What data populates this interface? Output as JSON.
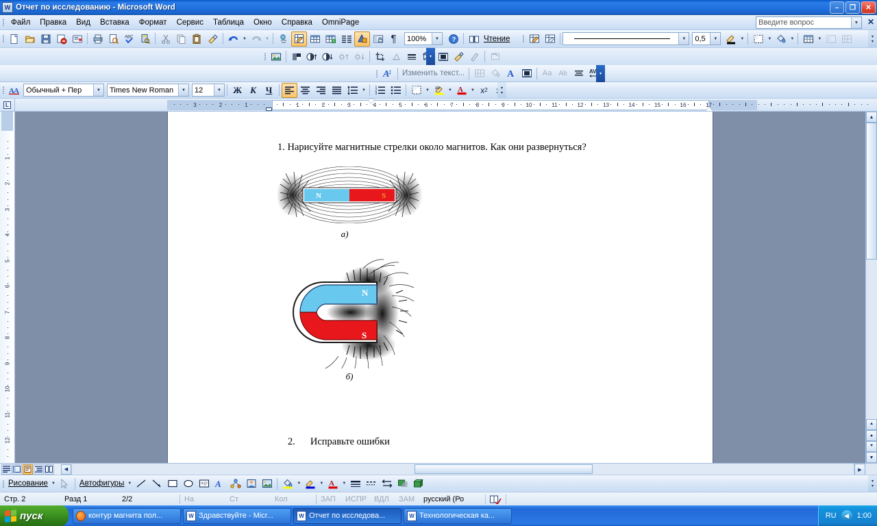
{
  "window": {
    "title": "Отчет по исследованию - Microsoft Word",
    "app_icon": "word-document-icon",
    "minimize": "–",
    "maximize": "❐",
    "close": "✕"
  },
  "menu": {
    "items": [
      {
        "label": "Файл",
        "accel": "Ф"
      },
      {
        "label": "Правка",
        "accel": "П"
      },
      {
        "label": "Вид",
        "accel": "В"
      },
      {
        "label": "Вставка",
        "accel": "а"
      },
      {
        "label": "Формат",
        "accel": "м"
      },
      {
        "label": "Сервис",
        "accel": "р"
      },
      {
        "label": "Таблица",
        "accel": "Т"
      },
      {
        "label": "Окно",
        "accel": "О"
      },
      {
        "label": "Справка",
        "accel": "С"
      },
      {
        "label": "OmniPage",
        "accel": ""
      }
    ],
    "ask_placeholder": "Введите вопрос",
    "close_document": "✕"
  },
  "standard_toolbar": {
    "zoom_value": "100%",
    "reading_label": "Чтение",
    "icons": [
      "new-document-icon",
      "open-folder-icon",
      "save-icon",
      "mail-icon",
      "print-preview-mail-icon",
      "print-icon",
      "preview-icon",
      "spellcheck-icon",
      "research-icon",
      "cut-icon",
      "copy-icon",
      "paste-icon",
      "format-painter-icon",
      "undo-icon",
      "redo-icon",
      "hyperlink-icon",
      "tables-borders-icon",
      "insert-table-icon",
      "insert-excel-icon",
      "columns-icon",
      "drawing-icon",
      "document-map-icon",
      "show-formatting-icon",
      "help-icon"
    ]
  },
  "line_toolbar": {
    "line_style_value": "———————————",
    "line_weight_value": "0,5",
    "icons": [
      "draw-table-icon",
      "eraser-icon",
      "line-color-icon",
      "border-icon",
      "fill-color-icon",
      "outside-border-icon",
      "merge-cells-icon"
    ]
  },
  "picture_toolbar": {
    "icons": [
      "insert-picture-icon",
      "color-mode-icon",
      "more-contrast-icon",
      "less-contrast-icon",
      "more-brightness-icon",
      "less-brightness-icon",
      "crop-icon",
      "rotate-left-icon",
      "line-style-icon",
      "compress-picture-icon",
      "text-wrapping-icon",
      "format-picture-icon",
      "set-transparent-color-icon",
      "reset-picture-icon"
    ]
  },
  "wordart_toolbar": {
    "edit_text_label": "Изменить текст...",
    "icons": [
      "insert-wordart-icon",
      "wordart-gallery-icon",
      "format-wordart-icon",
      "wordart-shape-icon",
      "text-wrapping-icon",
      "same-letter-heights-icon",
      "vertical-text-icon",
      "wordart-alignment-icon",
      "character-spacing-icon"
    ]
  },
  "formatting_toolbar": {
    "style_value": "Обычный + Пер",
    "font_value": "Times New Roman",
    "size_value": "12",
    "bold": "Ж",
    "italic": "К",
    "underline": "Ч",
    "icons": [
      "styles-formatting-icon",
      "align-left-icon",
      "align-center-icon",
      "align-right-icon",
      "justify-icon",
      "line-spacing-icon",
      "numbered-list-icon",
      "bulleted-list-icon",
      "borders-icon",
      "highlight-icon",
      "font-color-icon",
      "superscript-icon",
      "subscript-icon"
    ]
  },
  "ruler": {
    "tab_stop_type": "L",
    "horizontal_ticks": [
      "3",
      "2",
      "1",
      "1",
      "2",
      "3",
      "4",
      "5",
      "6",
      "7",
      "8",
      "9",
      "10",
      "11",
      "12",
      "13",
      "14",
      "15",
      "16",
      "17"
    ],
    "vertical_ticks": [
      "1",
      "2",
      "3",
      "4",
      "5",
      "6",
      "7",
      "8",
      "9",
      "10",
      "11",
      "12"
    ]
  },
  "document": {
    "question_1": "1. Нарисуйте магнитные стрелки около магнитов. Как они развернуться?",
    "figure_a_caption": "а)",
    "figure_b_caption": "б)",
    "question_2_number": "2.",
    "question_2": "Исправьте ошибки",
    "bar_magnet": {
      "north_label": "N",
      "south_label": "S",
      "north_color": "#69c8ee",
      "south_color": "#e8171b"
    },
    "horseshoe_magnet": {
      "north_label": "N",
      "south_label": "S",
      "north_color": "#69c8ee",
      "south_color": "#e8171b"
    }
  },
  "drawing_toolbar": {
    "draw_label": "Рисование",
    "autoshapes_label": "Автофигуры",
    "icons": [
      "select-objects-icon",
      "line-icon",
      "arrow-icon",
      "rectangle-icon",
      "oval-icon",
      "text-box-icon",
      "insert-wordart-icon",
      "insert-diagram-icon",
      "insert-clipart-icon",
      "insert-picture-icon",
      "fill-color-icon",
      "line-color-icon",
      "font-color-icon",
      "line-style-icon",
      "dash-style-icon",
      "arrow-style-icon",
      "shadow-style-icon",
      "3d-style-icon"
    ]
  },
  "view_buttons": [
    "normal-view-icon",
    "web-layout-icon",
    "print-layout-icon",
    "outline-view-icon",
    "reading-view-icon"
  ],
  "status_bar": {
    "page": "Стр. 2",
    "section": "Разд 1",
    "page_of": "2/2",
    "at": "На",
    "line": "Ст",
    "column": "Кол",
    "rec": "ЗАП",
    "trk": "ИСПР",
    "ext": "ВДЛ",
    "ovr": "ЗАМ",
    "language": "русский (Ро",
    "spell_icon": "spellcheck-status-icon"
  },
  "taskbar": {
    "start_label": "пуск",
    "items": [
      {
        "label": "контур магнита пол...",
        "icon": "firefox-icon",
        "active": false
      },
      {
        "label": "Здравствуйте - Micr...",
        "icon": "word-document-icon",
        "active": false
      },
      {
        "label": "Отчет по исследова...",
        "icon": "word-document-icon",
        "active": true
      },
      {
        "label": "Технологическая ка...",
        "icon": "word-document-icon",
        "active": false
      }
    ],
    "language_indicator": "RU",
    "clock": "1:00",
    "tray_arrow": "chevron-left-icon"
  }
}
